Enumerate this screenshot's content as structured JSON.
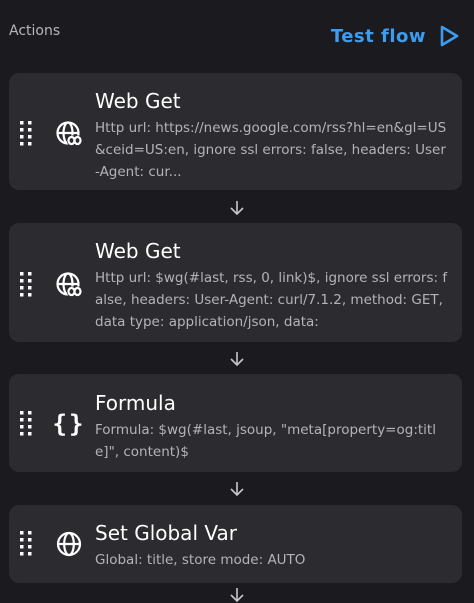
{
  "header": {
    "title": "Actions",
    "test_flow_label": "Test flow"
  },
  "actions": [
    {
      "icon": "web-link-icon",
      "title": "Web Get",
      "description": "Http url: https://news.google.com/rss?hl=en&gl=US&ceid=US:en, ignore ssl errors: false, headers: User-Agent: cur..."
    },
    {
      "icon": "web-link-icon",
      "title": "Web Get",
      "description": "Http url: $wg(#last, rss, 0, link)$, ignore ssl errors: false, headers: User-Agent: curl/7.1.2, method: GET, data type: application/json, data:"
    },
    {
      "icon": "braces-icon",
      "title": "Formula",
      "description": "Formula: $wg(#last, jsoup, \"meta[property=og:title]\", content)$"
    },
    {
      "icon": "globe-icon",
      "title": "Set Global Var",
      "description": "Global: title, store mode: AUTO"
    }
  ],
  "colors": {
    "background": "#1b1b1f",
    "card": "#2b2b30",
    "accent": "#3d9cf0",
    "muted_text": "#b3b3b9"
  }
}
